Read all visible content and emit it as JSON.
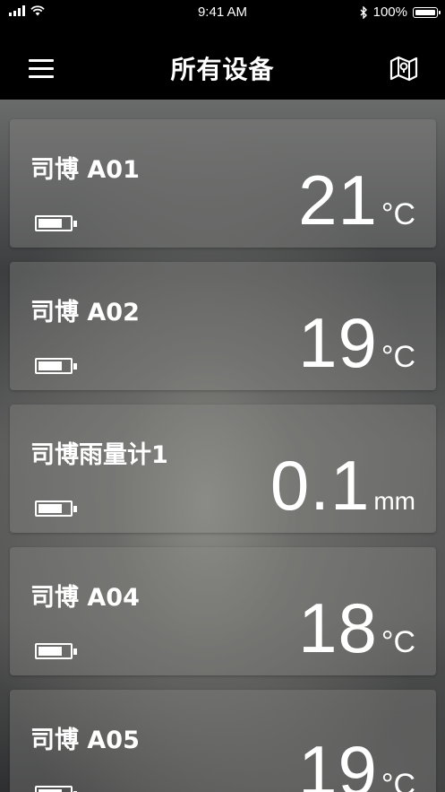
{
  "status_bar": {
    "time": "9:41 AM",
    "battery_percent": "100%",
    "icons": [
      "signal-icon",
      "wifi-icon",
      "bluetooth-icon",
      "battery-icon"
    ]
  },
  "nav": {
    "title": "所有设备",
    "menu_icon": "hamburger-menu-icon",
    "map_icon": "map-icon"
  },
  "devices": [
    {
      "name": "司博 A01",
      "value": "21",
      "unit": "°C",
      "battery_level": 0.65
    },
    {
      "name": "司博 A02",
      "value": "19",
      "unit": "°C",
      "battery_level": 0.65
    },
    {
      "name": "司博雨量计1",
      "value": "0.1",
      "unit": "mm",
      "battery_level": 0.65
    },
    {
      "name": "司博 A04",
      "value": "18",
      "unit": "°C",
      "battery_level": 0.65
    },
    {
      "name": "司博 A05",
      "value": "19",
      "unit": "°C",
      "battery_level": 0.65
    }
  ]
}
